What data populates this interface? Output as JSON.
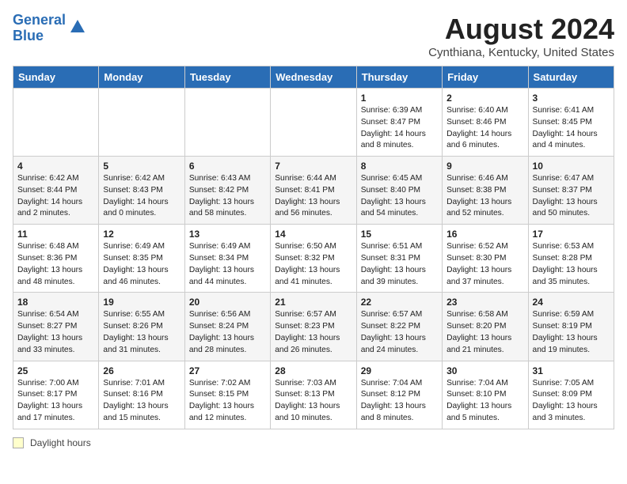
{
  "header": {
    "logo_line1": "General",
    "logo_line2": "Blue",
    "title": "August 2024",
    "subtitle": "Cynthiana, Kentucky, United States"
  },
  "weekdays": [
    "Sunday",
    "Monday",
    "Tuesday",
    "Wednesday",
    "Thursday",
    "Friday",
    "Saturday"
  ],
  "weeks": [
    [
      {
        "day": "",
        "info": ""
      },
      {
        "day": "",
        "info": ""
      },
      {
        "day": "",
        "info": ""
      },
      {
        "day": "",
        "info": ""
      },
      {
        "day": "1",
        "info": "Sunrise: 6:39 AM\nSunset: 8:47 PM\nDaylight: 14 hours\nand 8 minutes."
      },
      {
        "day": "2",
        "info": "Sunrise: 6:40 AM\nSunset: 8:46 PM\nDaylight: 14 hours\nand 6 minutes."
      },
      {
        "day": "3",
        "info": "Sunrise: 6:41 AM\nSunset: 8:45 PM\nDaylight: 14 hours\nand 4 minutes."
      }
    ],
    [
      {
        "day": "4",
        "info": "Sunrise: 6:42 AM\nSunset: 8:44 PM\nDaylight: 14 hours\nand 2 minutes."
      },
      {
        "day": "5",
        "info": "Sunrise: 6:42 AM\nSunset: 8:43 PM\nDaylight: 14 hours\nand 0 minutes."
      },
      {
        "day": "6",
        "info": "Sunrise: 6:43 AM\nSunset: 8:42 PM\nDaylight: 13 hours\nand 58 minutes."
      },
      {
        "day": "7",
        "info": "Sunrise: 6:44 AM\nSunset: 8:41 PM\nDaylight: 13 hours\nand 56 minutes."
      },
      {
        "day": "8",
        "info": "Sunrise: 6:45 AM\nSunset: 8:40 PM\nDaylight: 13 hours\nand 54 minutes."
      },
      {
        "day": "9",
        "info": "Sunrise: 6:46 AM\nSunset: 8:38 PM\nDaylight: 13 hours\nand 52 minutes."
      },
      {
        "day": "10",
        "info": "Sunrise: 6:47 AM\nSunset: 8:37 PM\nDaylight: 13 hours\nand 50 minutes."
      }
    ],
    [
      {
        "day": "11",
        "info": "Sunrise: 6:48 AM\nSunset: 8:36 PM\nDaylight: 13 hours\nand 48 minutes."
      },
      {
        "day": "12",
        "info": "Sunrise: 6:49 AM\nSunset: 8:35 PM\nDaylight: 13 hours\nand 46 minutes."
      },
      {
        "day": "13",
        "info": "Sunrise: 6:49 AM\nSunset: 8:34 PM\nDaylight: 13 hours\nand 44 minutes."
      },
      {
        "day": "14",
        "info": "Sunrise: 6:50 AM\nSunset: 8:32 PM\nDaylight: 13 hours\nand 41 minutes."
      },
      {
        "day": "15",
        "info": "Sunrise: 6:51 AM\nSunset: 8:31 PM\nDaylight: 13 hours\nand 39 minutes."
      },
      {
        "day": "16",
        "info": "Sunrise: 6:52 AM\nSunset: 8:30 PM\nDaylight: 13 hours\nand 37 minutes."
      },
      {
        "day": "17",
        "info": "Sunrise: 6:53 AM\nSunset: 8:28 PM\nDaylight: 13 hours\nand 35 minutes."
      }
    ],
    [
      {
        "day": "18",
        "info": "Sunrise: 6:54 AM\nSunset: 8:27 PM\nDaylight: 13 hours\nand 33 minutes."
      },
      {
        "day": "19",
        "info": "Sunrise: 6:55 AM\nSunset: 8:26 PM\nDaylight: 13 hours\nand 31 minutes."
      },
      {
        "day": "20",
        "info": "Sunrise: 6:56 AM\nSunset: 8:24 PM\nDaylight: 13 hours\nand 28 minutes."
      },
      {
        "day": "21",
        "info": "Sunrise: 6:57 AM\nSunset: 8:23 PM\nDaylight: 13 hours\nand 26 minutes."
      },
      {
        "day": "22",
        "info": "Sunrise: 6:57 AM\nSunset: 8:22 PM\nDaylight: 13 hours\nand 24 minutes."
      },
      {
        "day": "23",
        "info": "Sunrise: 6:58 AM\nSunset: 8:20 PM\nDaylight: 13 hours\nand 21 minutes."
      },
      {
        "day": "24",
        "info": "Sunrise: 6:59 AM\nSunset: 8:19 PM\nDaylight: 13 hours\nand 19 minutes."
      }
    ],
    [
      {
        "day": "25",
        "info": "Sunrise: 7:00 AM\nSunset: 8:17 PM\nDaylight: 13 hours\nand 17 minutes."
      },
      {
        "day": "26",
        "info": "Sunrise: 7:01 AM\nSunset: 8:16 PM\nDaylight: 13 hours\nand 15 minutes."
      },
      {
        "day": "27",
        "info": "Sunrise: 7:02 AM\nSunset: 8:15 PM\nDaylight: 13 hours\nand 12 minutes."
      },
      {
        "day": "28",
        "info": "Sunrise: 7:03 AM\nSunset: 8:13 PM\nDaylight: 13 hours\nand 10 minutes."
      },
      {
        "day": "29",
        "info": "Sunrise: 7:04 AM\nSunset: 8:12 PM\nDaylight: 13 hours\nand 8 minutes."
      },
      {
        "day": "30",
        "info": "Sunrise: 7:04 AM\nSunset: 8:10 PM\nDaylight: 13 hours\nand 5 minutes."
      },
      {
        "day": "31",
        "info": "Sunrise: 7:05 AM\nSunset: 8:09 PM\nDaylight: 13 hours\nand 3 minutes."
      }
    ]
  ],
  "footer": {
    "legend_label": "Daylight hours"
  }
}
